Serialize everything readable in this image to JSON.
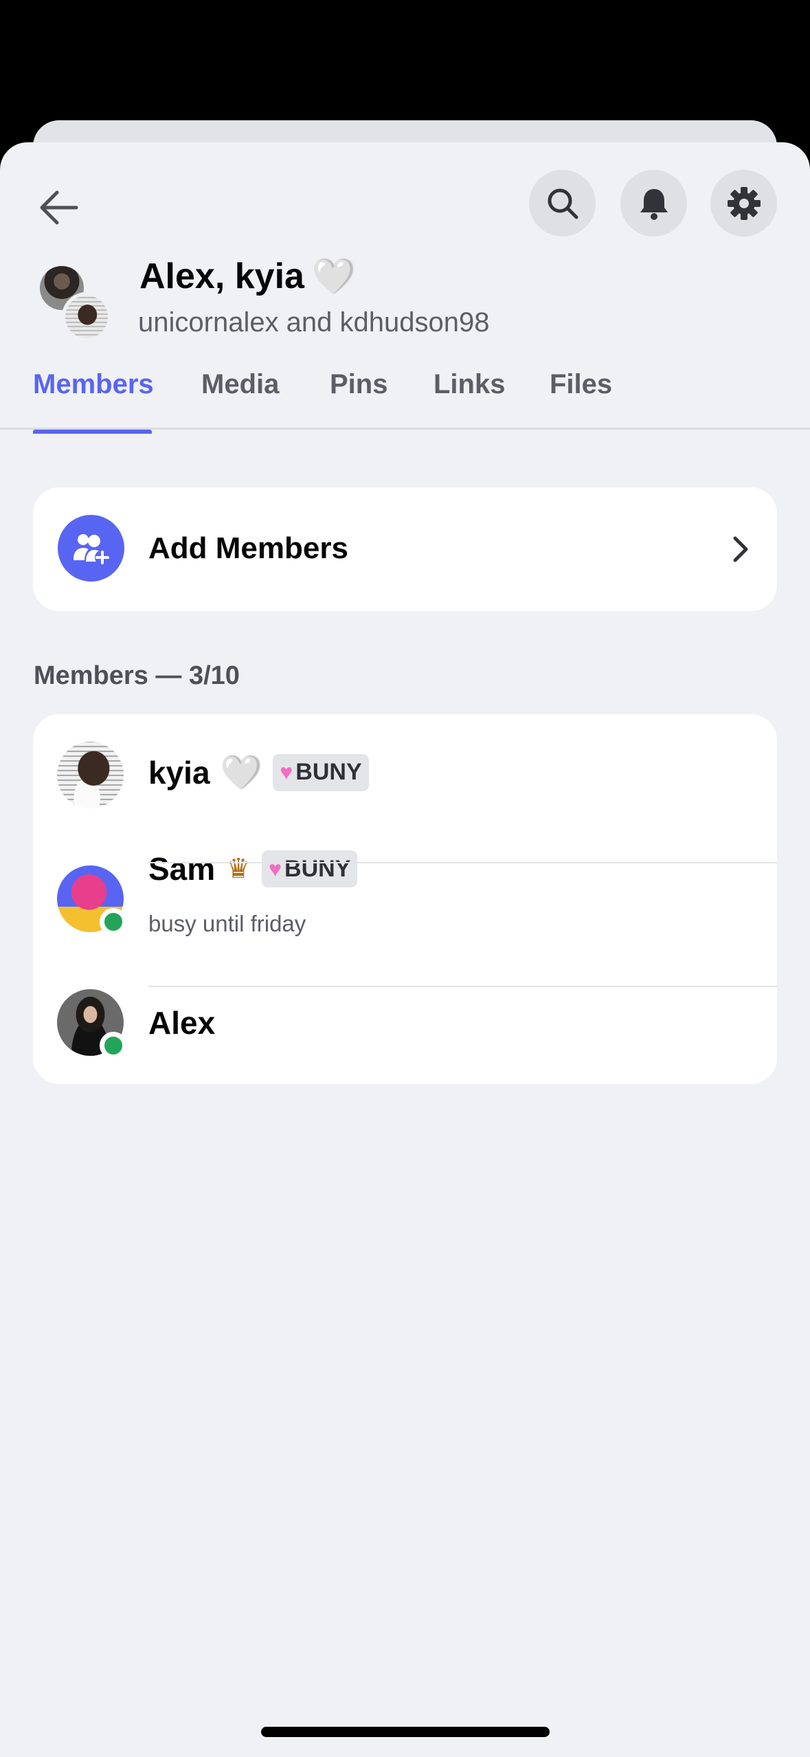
{
  "header": {
    "title": "Alex, kyia",
    "title_emoji": "🤍",
    "subtitle": "unicornalex and kdhudson98"
  },
  "icons": {
    "back": "arrow-left-icon",
    "search": "search-icon",
    "notifications": "bell-icon",
    "settings": "gear-icon",
    "add_members": "add-user-icon",
    "chevron": "chevron-right-icon"
  },
  "tabs": [
    {
      "label": "Members",
      "active": true
    },
    {
      "label": "Media",
      "active": false
    },
    {
      "label": "Pins",
      "active": false
    },
    {
      "label": "Links",
      "active": false
    },
    {
      "label": "Files",
      "active": false
    }
  ],
  "add_members": {
    "label": "Add Members"
  },
  "members_section": {
    "title": "Members — 3/10"
  },
  "members": [
    {
      "name": "kyia",
      "emoji": "🤍",
      "tag": "BUNY",
      "status": "",
      "online": false
    },
    {
      "name": "Sam",
      "badge": "crown",
      "tag": "BUNY",
      "status": "busy until friday",
      "online": true
    },
    {
      "name": "Alex",
      "tag": "",
      "status": "",
      "online": true
    }
  ],
  "colors": {
    "accent": "#5865f2",
    "online": "#23a559",
    "background": "#f0f1f4",
    "crown": "#b06f12"
  }
}
